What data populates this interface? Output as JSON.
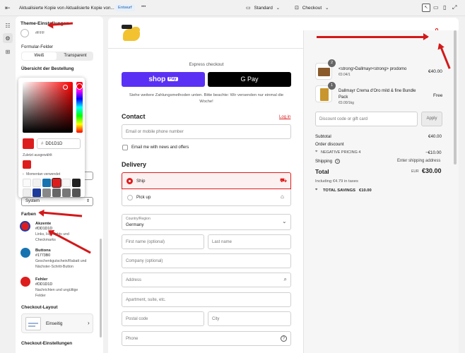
{
  "topbar": {
    "title": "Aktualisierte Kopie von Aktualisierte Kopie von...",
    "badge": "Entwurf",
    "more": "•••",
    "theme_select": "Standard",
    "page_select": "Checkout"
  },
  "panel": {
    "section_title": "Theme-Einstellungen",
    "color_hex_top": "#FFF",
    "formular_label": "Formular-Felder",
    "formular_options": [
      "Weiß",
      "Transparent"
    ],
    "order_summary_label": "Übersicht der Bestellung",
    "picker": {
      "hex_prefix": "#",
      "hex_value": "DD1D1D",
      "recent_label": "Zuletzt ausgewählt",
      "currently_used_label": "Momentan verwendet"
    },
    "system_select": "System",
    "farben_label": "Farben",
    "colors": [
      {
        "name": "Akzente",
        "hex": "#DD1D1D",
        "desc": "Links, Highlights und Checkmarks",
        "color": "#DD1D1D"
      },
      {
        "name": "Buttons",
        "hex": "#1773B0",
        "desc": "Geschenkgutschein/Rabatt und Nächster-Schritt-Button",
        "color": "#1773B0"
      },
      {
        "name": "Fehler",
        "hex": "#DD1D1D",
        "desc": "Nachrichten und ungültige Felder",
        "color": "#DD1D1D"
      }
    ],
    "checkout_layout_label": "Checkout-Layout",
    "layout_option": "Einseitig",
    "checkout_settings_label": "Checkout-Einstellungen"
  },
  "checkout": {
    "express_label": "Express checkout",
    "shoppay_label": "shop",
    "shoppay_badge": "Pay",
    "gpay_label": "G Pay",
    "notice": "Siehe weitere Zahlungsmethoden unten. Bitte beachte: Wir versenden nur einmal die Woche!",
    "contact_heading": "Contact",
    "login_link": "Log in",
    "email_placeholder": "Email or mobile phone number",
    "newsletter_label": "Email me with news and offers",
    "delivery_heading": "Delivery",
    "ship_label": "Ship",
    "pickup_label": "Pick up",
    "country_label": "Country/Region",
    "country_value": "Germany",
    "first_name": "First name (optional)",
    "last_name": "Last name",
    "company": "Company (optional)",
    "address": "Address",
    "apartment": "Apartment, suite, etc.",
    "postal": "Postal code",
    "city": "City",
    "phone": "Phone"
  },
  "summary": {
    "items": [
      {
        "qty": "2",
        "name": "<strong>Dallmayr<strong> prodomo",
        "sub": "€0.04/1",
        "price": "€40.00"
      },
      {
        "qty": "1",
        "name": "Dallmayr Crema d'Oro mild & fine Bundle Pack",
        "sub": "€0.00/1kg",
        "price": "Free"
      }
    ],
    "discount_placeholder": "Discount code or gift card",
    "apply_label": "Apply",
    "subtotal_label": "Subtotal",
    "subtotal_value": "€40.00",
    "order_discount_label": "Order discount",
    "discount_code": "NEGATIVE PRICING 4",
    "discount_value": "−€10.00",
    "shipping_label": "Shipping",
    "shipping_value": "Enter shipping address",
    "total_label": "Total",
    "currency": "EUR",
    "total_value": "€30.00",
    "tax_note": "Including €4.79 in taxes",
    "savings_label": "TOTAL SAVINGS",
    "savings_value": "€10.00"
  }
}
